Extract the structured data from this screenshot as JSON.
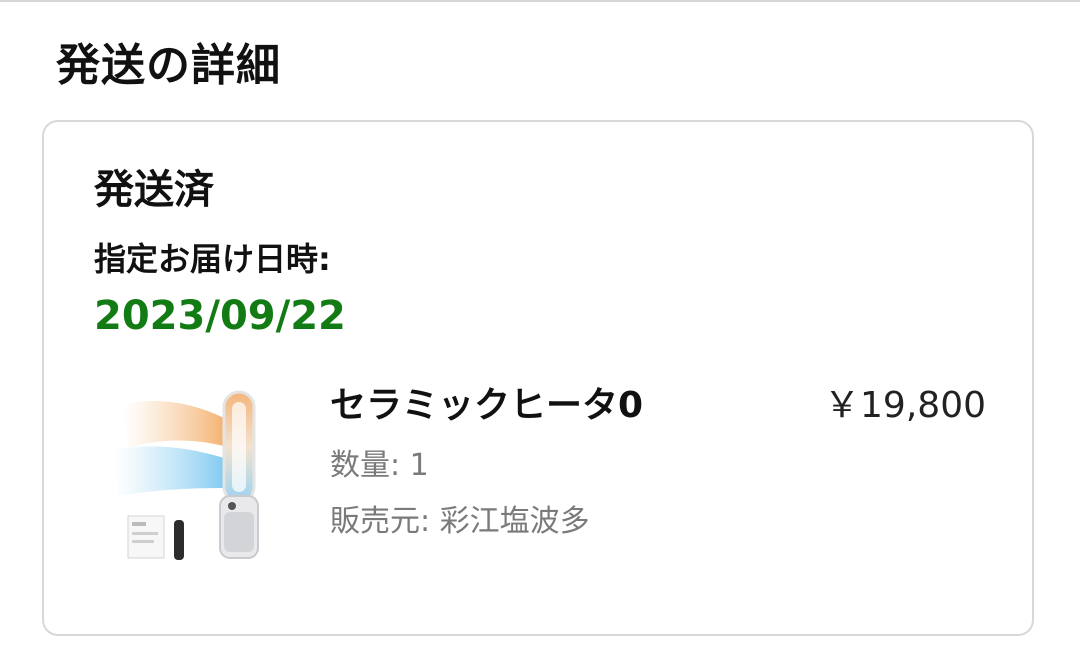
{
  "page": {
    "title": "発送の詳細"
  },
  "shipment": {
    "status": "発送済",
    "delivery_label": "指定お届け日時:",
    "delivery_date": "2023/09/22",
    "date_color": "#137b13"
  },
  "item": {
    "name": "セラミックヒータ0",
    "price": "￥19,800",
    "quantity_label": "数量: 1",
    "seller_label": "販売元: 彩江塩波多",
    "image_icon": "tower-fan-heater-product-image"
  }
}
